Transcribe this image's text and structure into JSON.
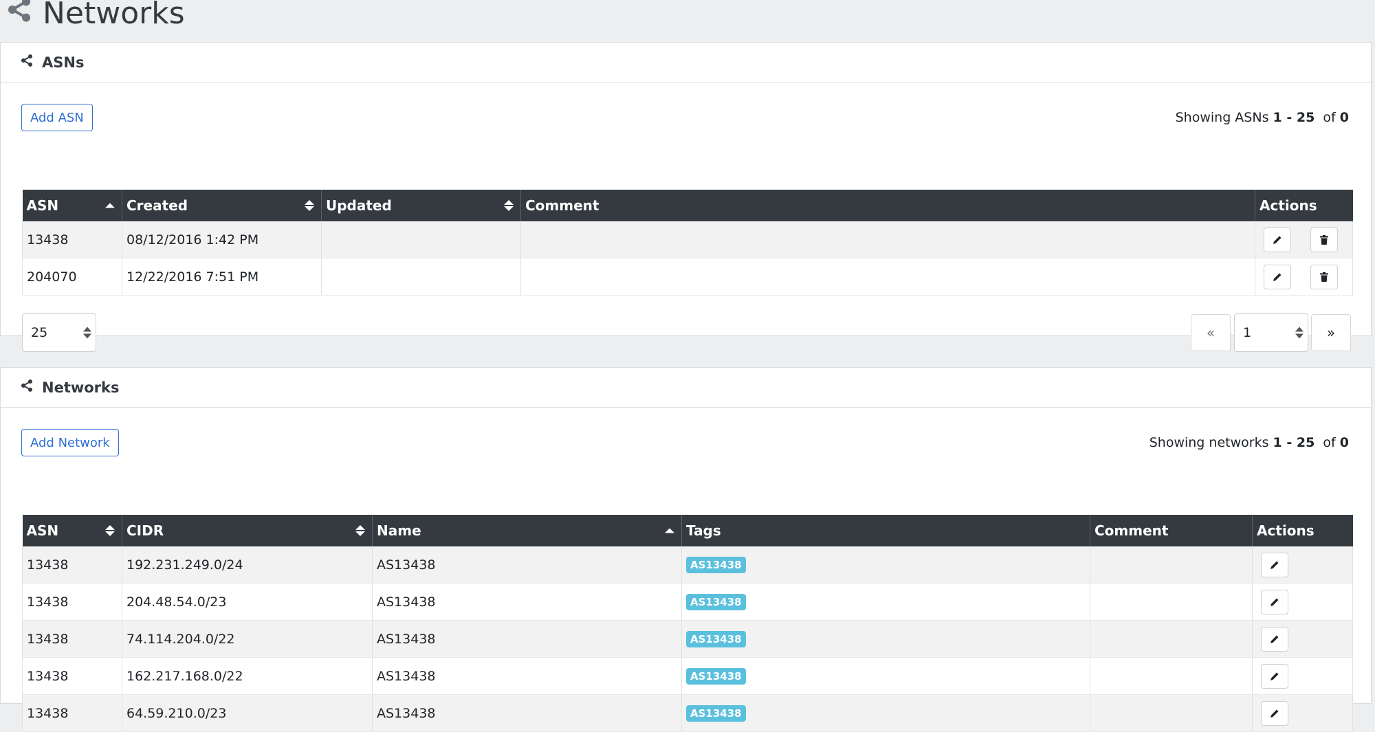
{
  "page": {
    "title": "Networks"
  },
  "asns": {
    "panel_title": "ASNs",
    "add_label": "Add ASN",
    "showing_prefix": "Showing ASNs",
    "range": "1 - 25",
    "of_label": "of",
    "total": "0",
    "columns": [
      "ASN",
      "Created",
      "Updated",
      "Comment",
      "Actions"
    ],
    "rows": [
      {
        "asn": "13438",
        "created": "08/12/2016 1:42 PM",
        "updated": "",
        "comment": ""
      },
      {
        "asn": "204070",
        "created": "12/22/2016 7:51 PM",
        "updated": "",
        "comment": ""
      }
    ],
    "per_page": "25",
    "pagination": {
      "prev": "«",
      "page": "1",
      "next": "»"
    }
  },
  "networks": {
    "panel_title": "Networks",
    "add_label": "Add Network",
    "showing_prefix": "Showing networks",
    "range": "1 - 25",
    "of_label": "of",
    "total": "0",
    "columns": [
      "ASN",
      "CIDR",
      "Name",
      "Tags",
      "Comment",
      "Actions"
    ],
    "rows": [
      {
        "asn": "13438",
        "cidr": "192.231.249.0/24",
        "name": "AS13438",
        "tag": "AS13438",
        "comment": ""
      },
      {
        "asn": "13438",
        "cidr": "204.48.54.0/23",
        "name": "AS13438",
        "tag": "AS13438",
        "comment": ""
      },
      {
        "asn": "13438",
        "cidr": "74.114.204.0/22",
        "name": "AS13438",
        "tag": "AS13438",
        "comment": ""
      },
      {
        "asn": "13438",
        "cidr": "162.217.168.0/22",
        "name": "AS13438",
        "tag": "AS13438",
        "comment": ""
      },
      {
        "asn": "13438",
        "cidr": "64.59.210.0/23",
        "name": "AS13438",
        "tag": "AS13438",
        "comment": ""
      }
    ]
  },
  "colors": {
    "primary": "#2f6fd0",
    "header_dark": "#343a40",
    "tag_info": "#5bc0de"
  }
}
